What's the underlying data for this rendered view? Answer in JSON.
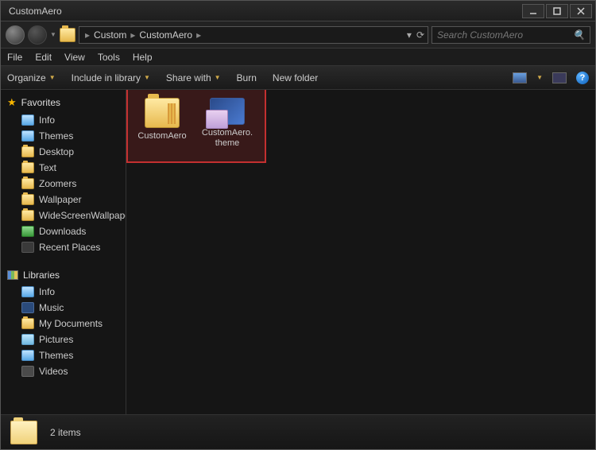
{
  "window": {
    "title": "CustomAero"
  },
  "breadcrumb": {
    "segments": [
      "Custom",
      "CustomAero"
    ]
  },
  "search": {
    "placeholder": "Search CustomAero"
  },
  "menubar": [
    "File",
    "Edit",
    "View",
    "Tools",
    "Help"
  ],
  "commandbar": {
    "organize": "Organize",
    "include": "Include in library",
    "share": "Share with",
    "burn": "Burn",
    "newfolder": "New folder"
  },
  "sidebar": {
    "favorites": {
      "label": "Favorites",
      "items": [
        "Info",
        "Themes",
        "Desktop",
        "Text",
        "Zoomers",
        "Wallpaper",
        "WideScreenWallpaper",
        "Downloads",
        "Recent Places"
      ]
    },
    "libraries": {
      "label": "Libraries",
      "items": [
        "Info",
        "Music",
        "My Documents",
        "Pictures",
        "Themes",
        "Videos"
      ]
    }
  },
  "content": {
    "items": [
      {
        "name": "CustomAero",
        "type": "folder"
      },
      {
        "name": "CustomAero.theme",
        "type": "theme"
      }
    ]
  },
  "statusbar": {
    "text": "2 items"
  }
}
